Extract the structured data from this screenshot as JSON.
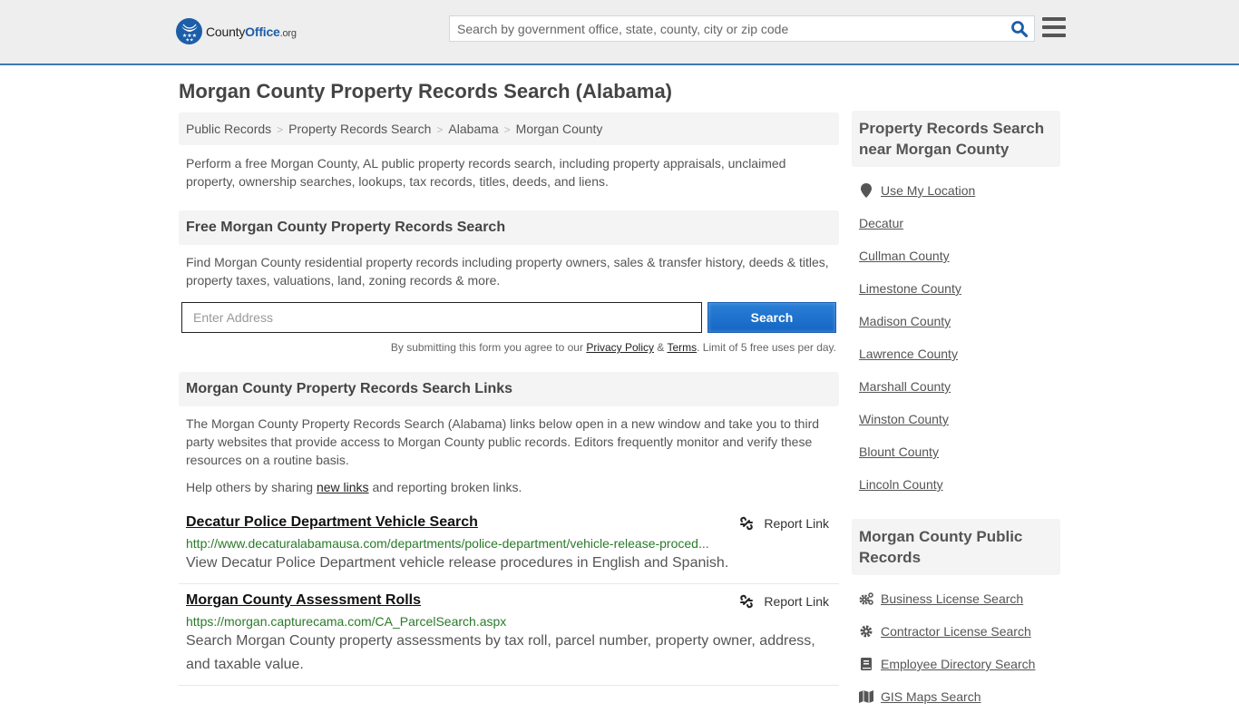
{
  "header": {
    "logo": {
      "prefix": "County",
      "brand": "Office",
      "tld": ".org"
    },
    "search_placeholder": "Search by government office, state, county, city or zip code",
    "search_icon": "search-icon",
    "menu_icon": "hamburger-menu-icon"
  },
  "page_title": "Morgan County Property Records Search (Alabama)",
  "breadcrumb": [
    "Public Records",
    "Property Records Search",
    "Alabama",
    "Morgan County"
  ],
  "intro": "Perform a free Morgan County, AL public property records search, including property appraisals, unclaimed property, ownership searches, lookups, tax records, titles, deeds, and liens.",
  "free_search": {
    "heading": "Free Morgan County Property Records Search",
    "description": "Find Morgan County residential property records including property owners, sales & transfer history, deeds & titles, property taxes, valuations, land, zoning records & more.",
    "address_placeholder": "Enter Address",
    "button_label": "Search",
    "disclaimer_prefix": "By submitting this form you agree to our ",
    "privacy_label": "Privacy Policy",
    "amp": " & ",
    "terms_label": "Terms",
    "disclaimer_suffix": ". Limit of 5 free uses per day."
  },
  "links_section": {
    "heading": "Morgan County Property Records Search Links",
    "description": "The Morgan County Property Records Search (Alabama) links below open in a new window and take you to third party websites that provide access to Morgan County public records. Editors frequently monitor and verify these resources on a routine basis.",
    "help_prefix": "Help others by sharing ",
    "help_link": "new links",
    "help_suffix": " and reporting broken links.",
    "report_label": "Report Link",
    "items": [
      {
        "title": "Decatur Police Department Vehicle Search",
        "url": "http://www.decaturalabamausa.com/departments/police-department/vehicle-release-proced...",
        "description": "View Decatur Police Department vehicle release procedures in English and Spanish."
      },
      {
        "title": "Morgan County Assessment Rolls",
        "url": "https://morgan.capturecama.com/CA_ParcelSearch.aspx",
        "description": "Search Morgan County property assessments by tax roll, parcel number, property owner, address, and taxable value."
      }
    ]
  },
  "sidebar": {
    "nearby": {
      "heading": "Property Records Search near Morgan County",
      "use_location": "Use My Location",
      "items": [
        "Decatur",
        "Cullman County",
        "Limestone County",
        "Madison County",
        "Lawrence County",
        "Marshall County",
        "Winston County",
        "Blount County",
        "Lincoln County"
      ]
    },
    "public_records": {
      "heading": "Morgan County Public Records",
      "items": [
        {
          "label": "Business License Search",
          "icon": "cogs-icon"
        },
        {
          "label": "Contractor License Search",
          "icon": "gear-icon"
        },
        {
          "label": "Employee Directory Search",
          "icon": "book-icon"
        },
        {
          "label": "GIS Maps Search",
          "icon": "map-icon"
        }
      ]
    }
  },
  "colors": {
    "accent": "#1d5ea8",
    "header_bg": "#eeeeee",
    "header_border": "#3d7ab5",
    "url_green": "#2a7a2a",
    "button_blue": "#1566c4"
  }
}
